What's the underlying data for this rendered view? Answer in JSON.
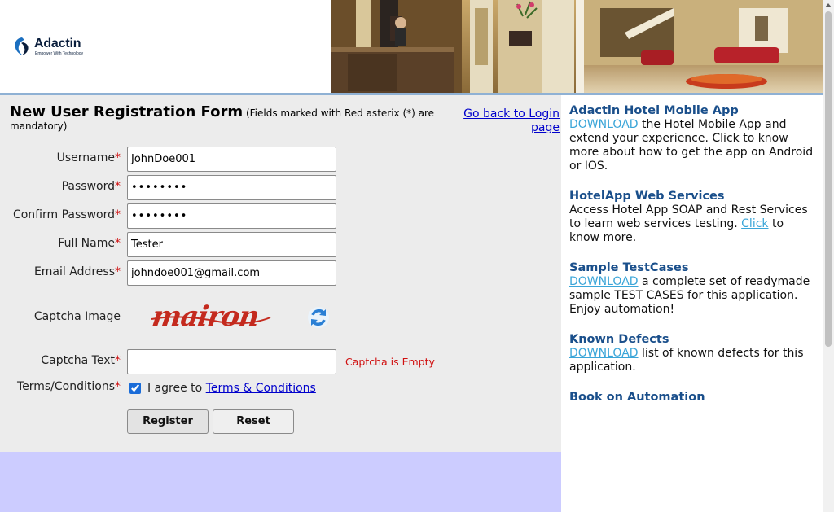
{
  "header": {
    "logo_name": "Adactin",
    "logo_tagline": "Empower With Technology"
  },
  "form": {
    "title": "New User Registration Form",
    "note": "(Fields marked with Red asterix (*) are mandatory)",
    "back_link_line1": "Go back to Login",
    "back_link_line2": "page",
    "required_mark": "*",
    "fields": {
      "username": {
        "label": "Username",
        "value": "JohnDoe001"
      },
      "password": {
        "label": "Password",
        "value": "••••••••"
      },
      "confirm_password": {
        "label": "Confirm Password",
        "value": "••••••••"
      },
      "full_name": {
        "label": "Full Name",
        "value": "Tester"
      },
      "email": {
        "label": "Email Address",
        "value": "johndoe001@gmail.com"
      },
      "captcha_image": {
        "label": "Captcha Image",
        "captcha_text": "mairon"
      },
      "captcha_text": {
        "label": "Captcha Text",
        "value": "",
        "error": "Captcha is Empty"
      },
      "terms": {
        "label": "Terms/Conditions",
        "prefix": "I agree to",
        "link": "Terms & Conditions",
        "checked": true
      }
    },
    "register_label": "Register",
    "reset_label": "Reset"
  },
  "sidebar": {
    "mobile_app": {
      "title": "Adactin Hotel Mobile App",
      "link": "DOWNLOAD",
      "text": "the Hotel Mobile App and extend your experience. Click to know more about how to get the app on Android or IOS."
    },
    "web_services": {
      "title": "HotelApp Web Services",
      "text_before": "Access Hotel App SOAP and Rest Services to learn web services testing.",
      "link": "Click",
      "text_after": "to know more."
    },
    "test_cases": {
      "title": "Sample TestCases",
      "link": "DOWNLOAD",
      "text": "a complete set of readymade sample TEST CASES for this application. Enjoy automation!"
    },
    "known_defects": {
      "title": "Known Defects",
      "link": "DOWNLOAD",
      "text": "list of known defects for this application."
    },
    "book": {
      "title": "Book on Automation"
    }
  },
  "colors": {
    "sidebar_title": "#1a4f8b",
    "sidebar_link": "#3aa5d8",
    "required": "#d01010",
    "form_bg": "#ececec",
    "footer_bg": "#ccccff"
  }
}
